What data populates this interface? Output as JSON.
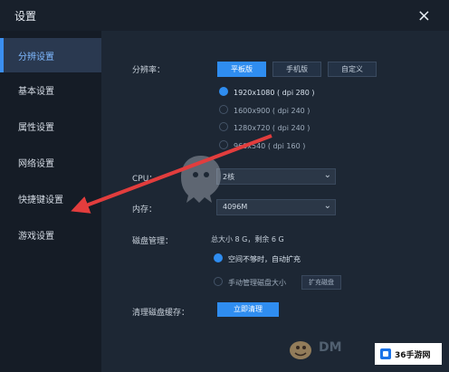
{
  "window": {
    "title": "设置",
    "close_icon": "close-icon"
  },
  "sidebar": {
    "items": [
      {
        "label": "分辨设置",
        "active": true
      },
      {
        "label": "基本设置"
      },
      {
        "label": "属性设置"
      },
      {
        "label": "网络设置"
      },
      {
        "label": "快捷键设置"
      },
      {
        "label": "游戏设置"
      }
    ]
  },
  "settings": {
    "resolution_label": "分辨率：",
    "tabs": [
      "平板版",
      "手机版",
      "自定义"
    ],
    "resolutions": [
      {
        "label": "1920x1080 ( dpi 280 )",
        "selected": true
      },
      {
        "label": "1600x900 ( dpi 240 )"
      },
      {
        "label": "1280x720 ( dpi 240 )"
      },
      {
        "label": "960x540 ( dpi 160 )"
      }
    ],
    "cpu_label": "CPU：",
    "cpu_value": "2核",
    "memory_label": "内存：",
    "memory_value": "4096M",
    "disk_label": "磁盘管理：",
    "disk_info": "总大小 8 G，剩余 6 G",
    "disk_options": [
      {
        "label": "空间不够时，自动扩充",
        "selected": true
      },
      {
        "label": "手动管理磁盘大小"
      }
    ],
    "expand_button": "扩充磁盘",
    "clear_cache_label": "清理磁盘缓存：",
    "clear_button": "立即清理"
  },
  "watermark": {
    "text": "36手游网",
    "ghost_text": "DM"
  }
}
